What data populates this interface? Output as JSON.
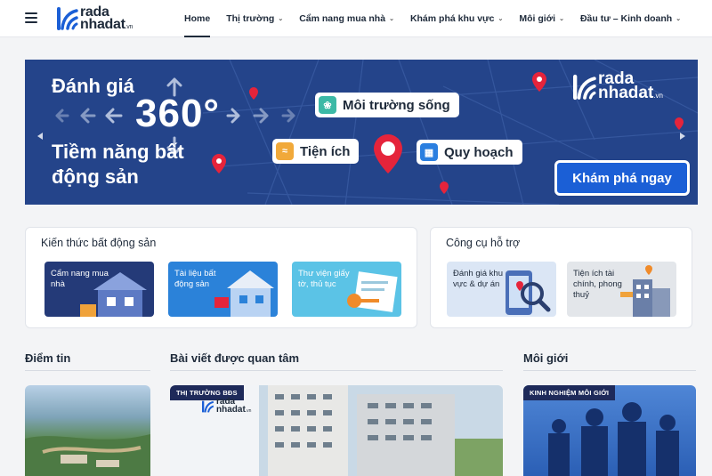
{
  "brand": {
    "logo_line1": "rada",
    "logo_line2": "nhadat",
    "logo_tld": ".vn"
  },
  "nav": {
    "items": [
      {
        "label": "Home",
        "active": true,
        "has_dropdown": false
      },
      {
        "label": "Thị trường",
        "active": false,
        "has_dropdown": true
      },
      {
        "label": "Cẩm nang mua nhà",
        "active": false,
        "has_dropdown": true
      },
      {
        "label": "Khám phá khu vực",
        "active": false,
        "has_dropdown": true
      },
      {
        "label": "Môi giới",
        "active": false,
        "has_dropdown": true
      },
      {
        "label": "Đầu tư – Kinh doanh",
        "active": false,
        "has_dropdown": true
      }
    ]
  },
  "banner": {
    "line1": "Đánh giá",
    "big": "360°",
    "line2": "Tiềm năng bất động sản",
    "tags": {
      "env": "Môi trường sống",
      "amenity": "Tiện ích",
      "planning": "Quy hoạch"
    },
    "cta": "Khám phá ngay",
    "colors": {
      "bg": "#24448a",
      "cta": "#1b5fd6",
      "pin": "#e5243b"
    }
  },
  "knowledge": {
    "title": "Kiến thức bất động sản",
    "cards": [
      {
        "label": "Cẩm nang mua nhà",
        "color": "#243a78"
      },
      {
        "label": "Tài liệu bất động sản",
        "color": "#2b82d9"
      },
      {
        "label": "Thư viện giấy tờ, thủ tục",
        "color": "#5bc3e6"
      }
    ]
  },
  "tools": {
    "title": "Công cụ hỗ trợ",
    "cards": [
      {
        "label": "Đánh giá khu vực & dự án",
        "color": "#dbe6f5"
      },
      {
        "label": "Tiện ích tài chính, phong thuỷ",
        "color": "#e3e6ea"
      }
    ]
  },
  "sections": {
    "news": {
      "title": "Điểm tin"
    },
    "featured": {
      "title": "Bài viết được quan tâm",
      "badge": "THỊ TRƯỜNG BĐS"
    },
    "agents": {
      "title": "Môi giới",
      "badge": "KINH NGHIỆM MÔI GIỚI"
    }
  }
}
